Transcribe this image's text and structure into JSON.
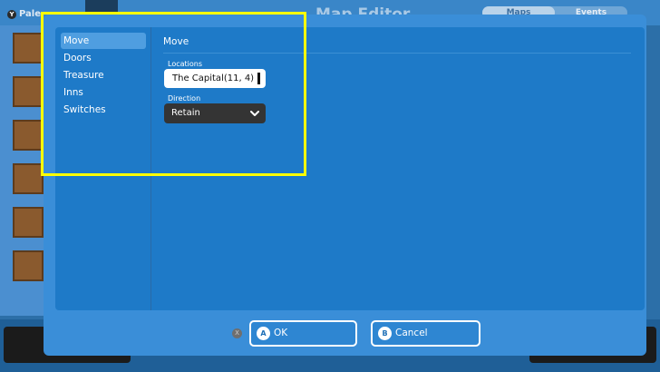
{
  "background": {
    "palette_label": "Pale",
    "palette_key": "Y",
    "editor_title": "Map Editor",
    "tabs": [
      {
        "label": "Maps"
      },
      {
        "label": "Events"
      }
    ]
  },
  "dialog": {
    "nav": [
      {
        "label": "Move",
        "selected": true
      },
      {
        "label": "Doors"
      },
      {
        "label": "Treasure"
      },
      {
        "label": "Inns"
      },
      {
        "label": "Switches"
      }
    ],
    "section_title": "Move",
    "locations_label": "Locations",
    "locations_value": "The Capital(11, 4)",
    "direction_label": "Direction",
    "direction_value": "Retain",
    "x_hint": "X",
    "ok": {
      "badge": "A",
      "label": "OK"
    },
    "cancel": {
      "badge": "B",
      "label": "Cancel"
    }
  },
  "colors": {
    "dialog_bg": "#3a8ed8",
    "panel_bg": "#1e7ac8",
    "selected_nav": "#4f9ee0",
    "highlight": "#ffff00"
  }
}
